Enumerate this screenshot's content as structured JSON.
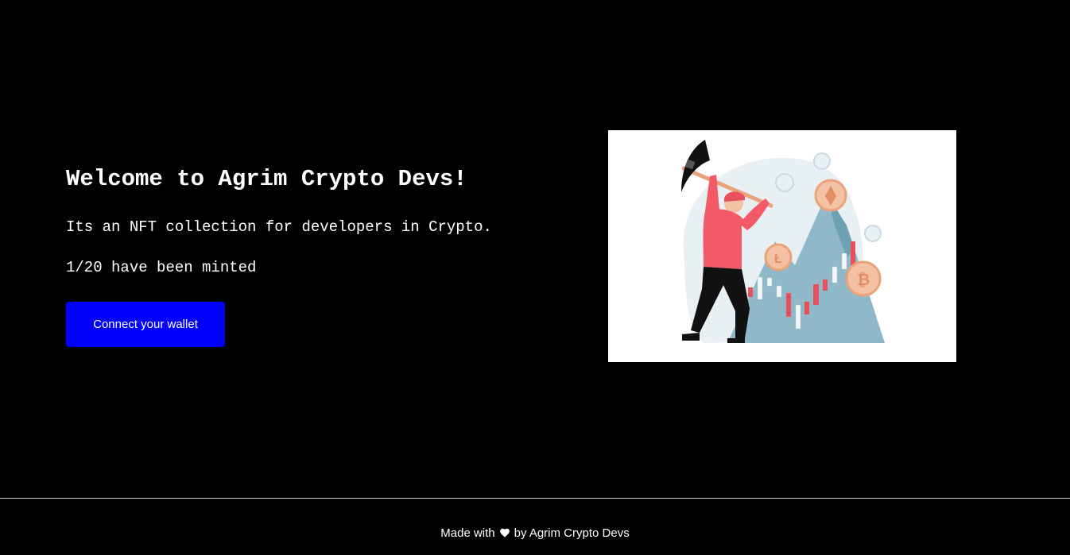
{
  "hero": {
    "title": "Welcome to Agrim Crypto Devs!",
    "description": "Its an NFT collection for developers in Crypto.",
    "minted_status": "1/20 have been minted",
    "connect_button_label": "Connect your wallet"
  },
  "illustration": {
    "icon": "crypto-miner-illustration"
  },
  "footer": {
    "made_with": "Made with",
    "heart_icon": "heart-icon",
    "by_text": "by Agrim Crypto Devs"
  },
  "colors": {
    "background": "#000000",
    "button": "#0000ff",
    "text": "#ffffff"
  }
}
